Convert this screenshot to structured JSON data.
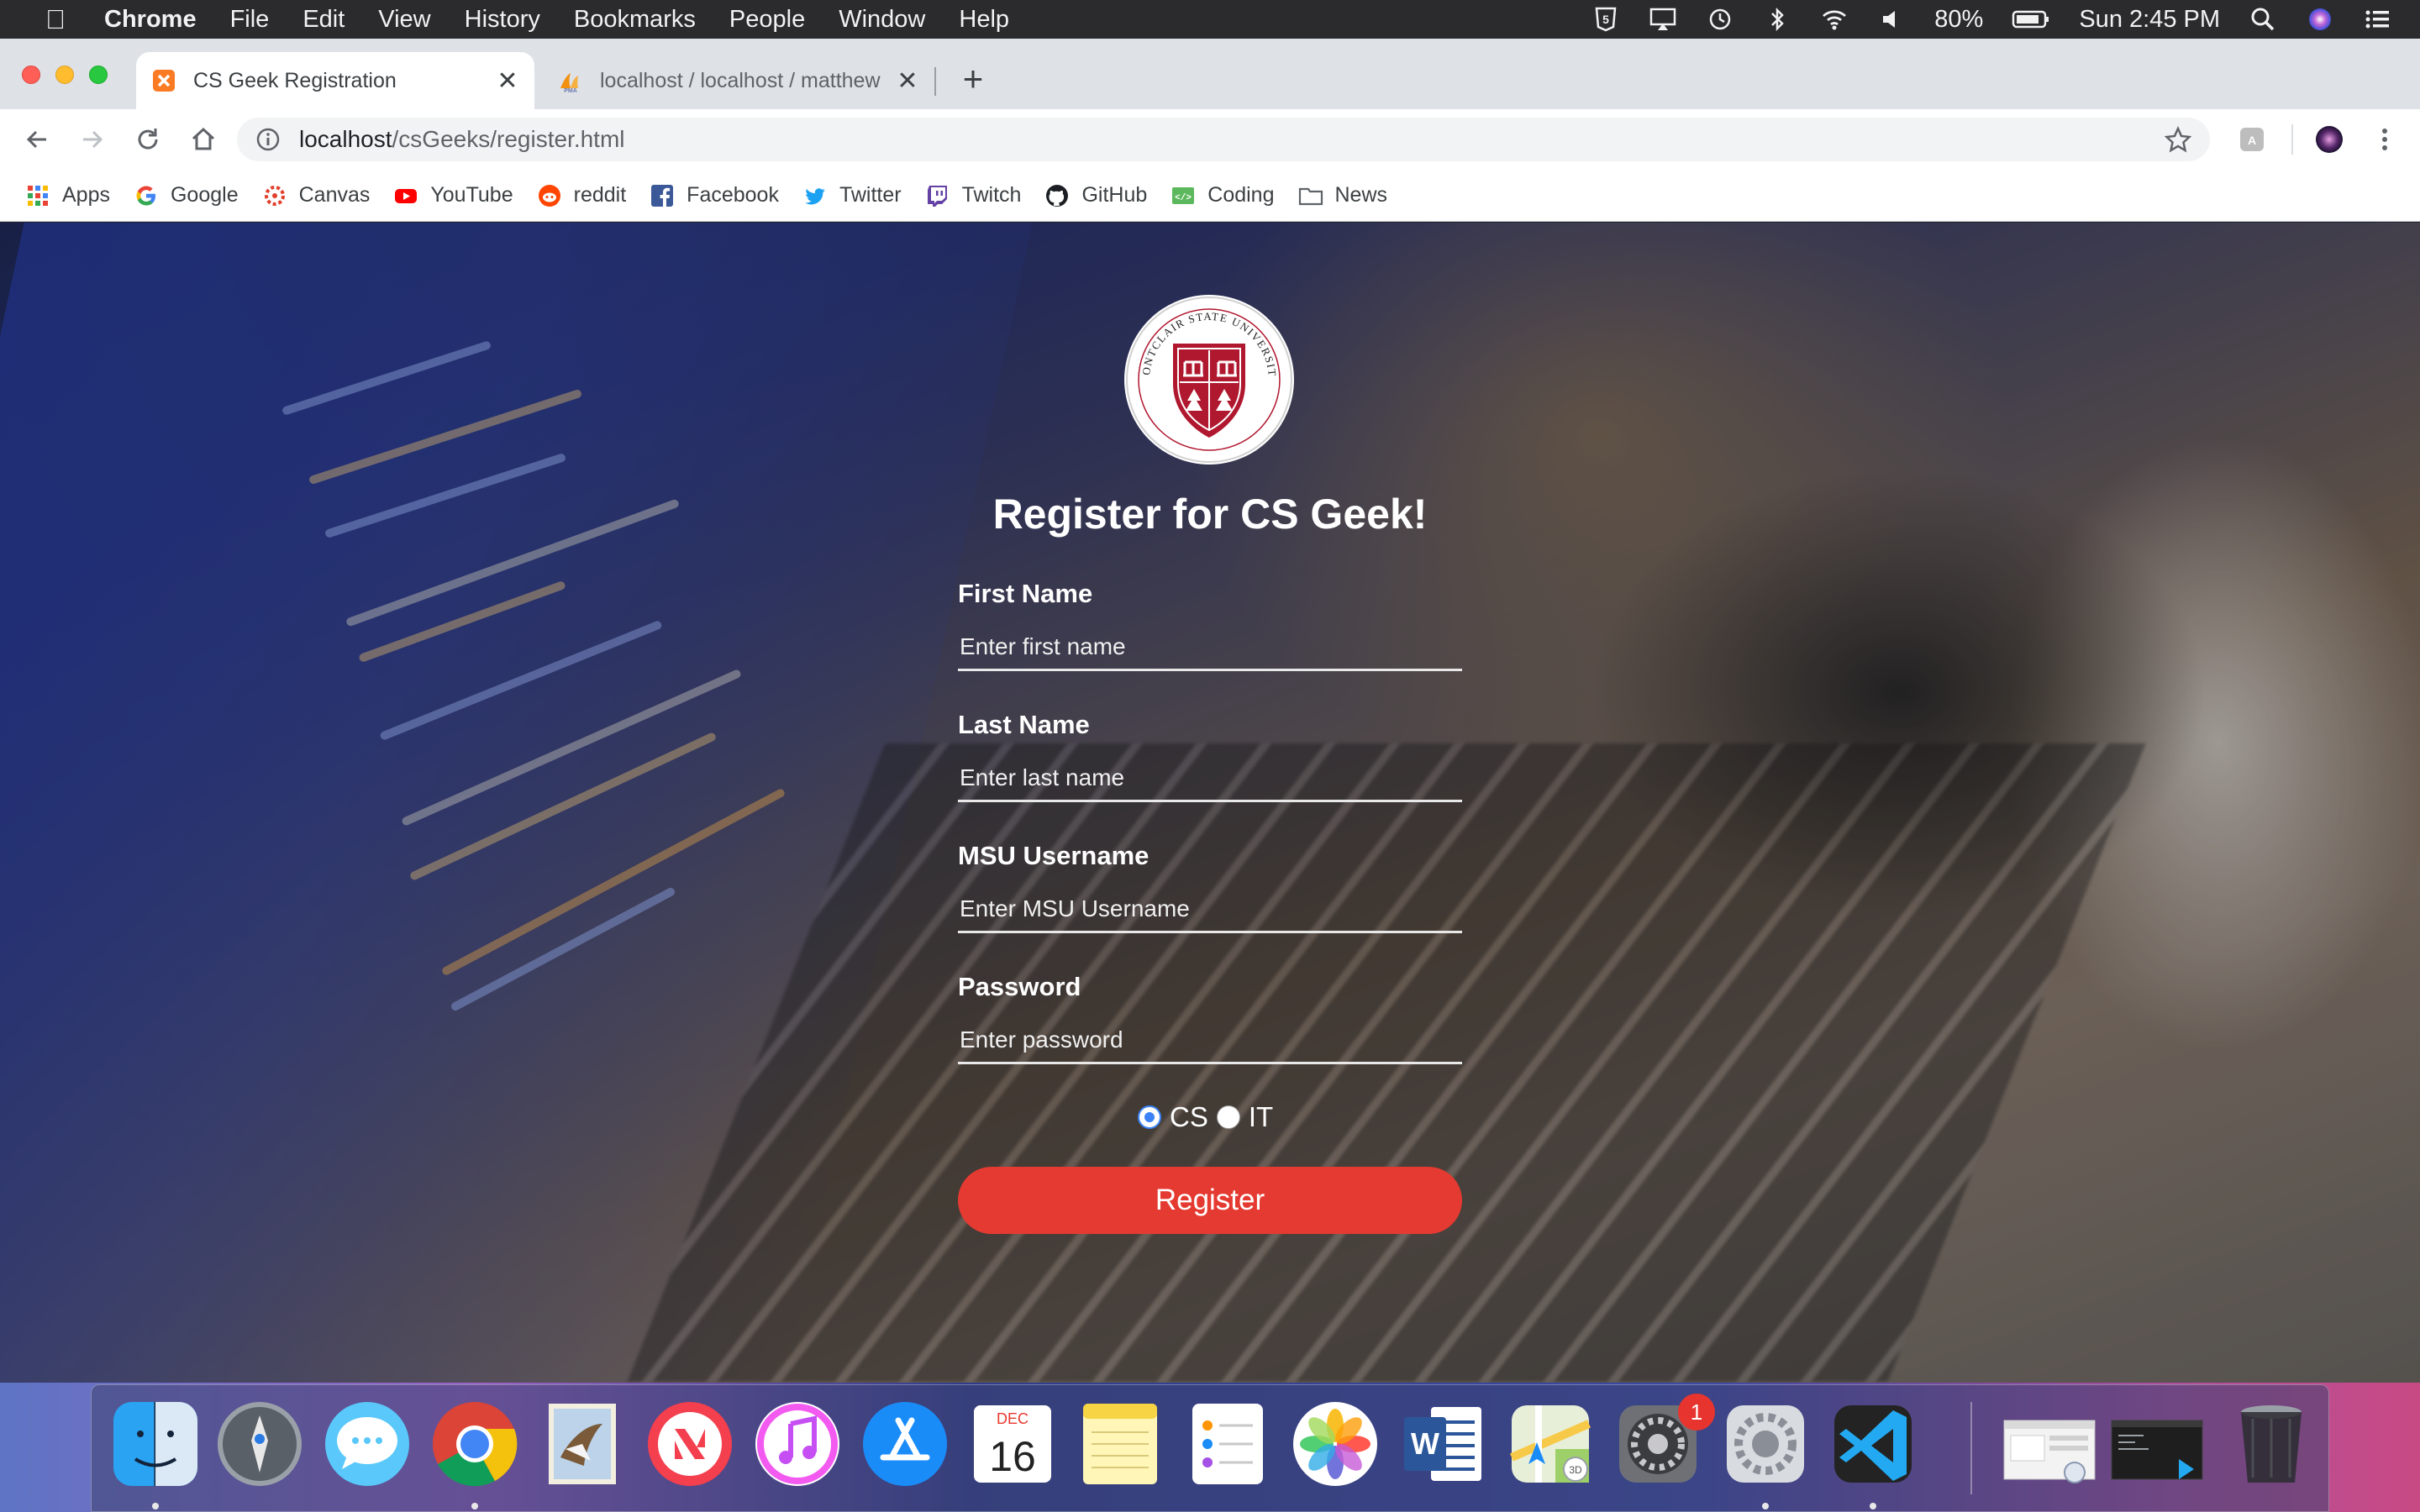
{
  "menubar": {
    "app_name": "Chrome",
    "menus": [
      "File",
      "Edit",
      "View",
      "History",
      "Bookmarks",
      "People",
      "Window",
      "Help"
    ],
    "battery": "80%",
    "clock": "Sun 2:45 PM"
  },
  "tabs": [
    {
      "title": "CS Geek Registration",
      "icon": "xampp-icon",
      "active": true
    },
    {
      "title": "localhost / localhost / matthew",
      "icon": "phpmyadmin-icon",
      "active": false
    }
  ],
  "address_bar": {
    "host": "localhost",
    "path": "/csGeeks/register.html"
  },
  "bookmarks": [
    {
      "label": "Apps",
      "icon": "apps-grid-icon"
    },
    {
      "label": "Google",
      "icon": "google-icon"
    },
    {
      "label": "Canvas",
      "icon": "canvas-icon"
    },
    {
      "label": "YouTube",
      "icon": "youtube-icon"
    },
    {
      "label": "reddit",
      "icon": "reddit-icon"
    },
    {
      "label": "Facebook",
      "icon": "facebook-icon"
    },
    {
      "label": "Twitter",
      "icon": "twitter-icon"
    },
    {
      "label": "Twitch",
      "icon": "twitch-icon"
    },
    {
      "label": "GitHub",
      "icon": "github-icon"
    },
    {
      "label": "Coding",
      "icon": "coding-icon"
    },
    {
      "label": "News",
      "icon": "folder-icon"
    }
  ],
  "logo": {
    "text": "MONTCLAIR STATE UNIVERSITY"
  },
  "form": {
    "title": "Register for CS Geek!",
    "fields": [
      {
        "label": "First Name",
        "placeholder": "Enter first name"
      },
      {
        "label": "Last Name",
        "placeholder": "Enter last name"
      },
      {
        "label": "MSU Username",
        "placeholder": "Enter MSU Username"
      },
      {
        "label": "Password",
        "placeholder": "Enter password"
      }
    ],
    "options": [
      {
        "label": "CS",
        "checked": true
      },
      {
        "label": "IT",
        "checked": false
      }
    ],
    "submit_label": "Register"
  },
  "dock": {
    "calendar_month": "DEC",
    "calendar_day": "16",
    "system_prefs_badge": "1",
    "apps": [
      "finder-icon",
      "launchpad-icon",
      "messages-icon",
      "chrome-icon",
      "mail-icon",
      "news-icon",
      "itunes-icon",
      "app-store-icon",
      "calendar-icon",
      "notes-icon",
      "reminders-icon",
      "photos-icon",
      "word-icon",
      "maps-icon",
      "system-preferences-icon",
      "settings-app-icon",
      "vscode-icon",
      "preview-window-icon",
      "terminal-window-icon",
      "trash-icon"
    ]
  },
  "colors": {
    "accent_button": "#e53a31",
    "radio_selected": "#3b82f6"
  }
}
